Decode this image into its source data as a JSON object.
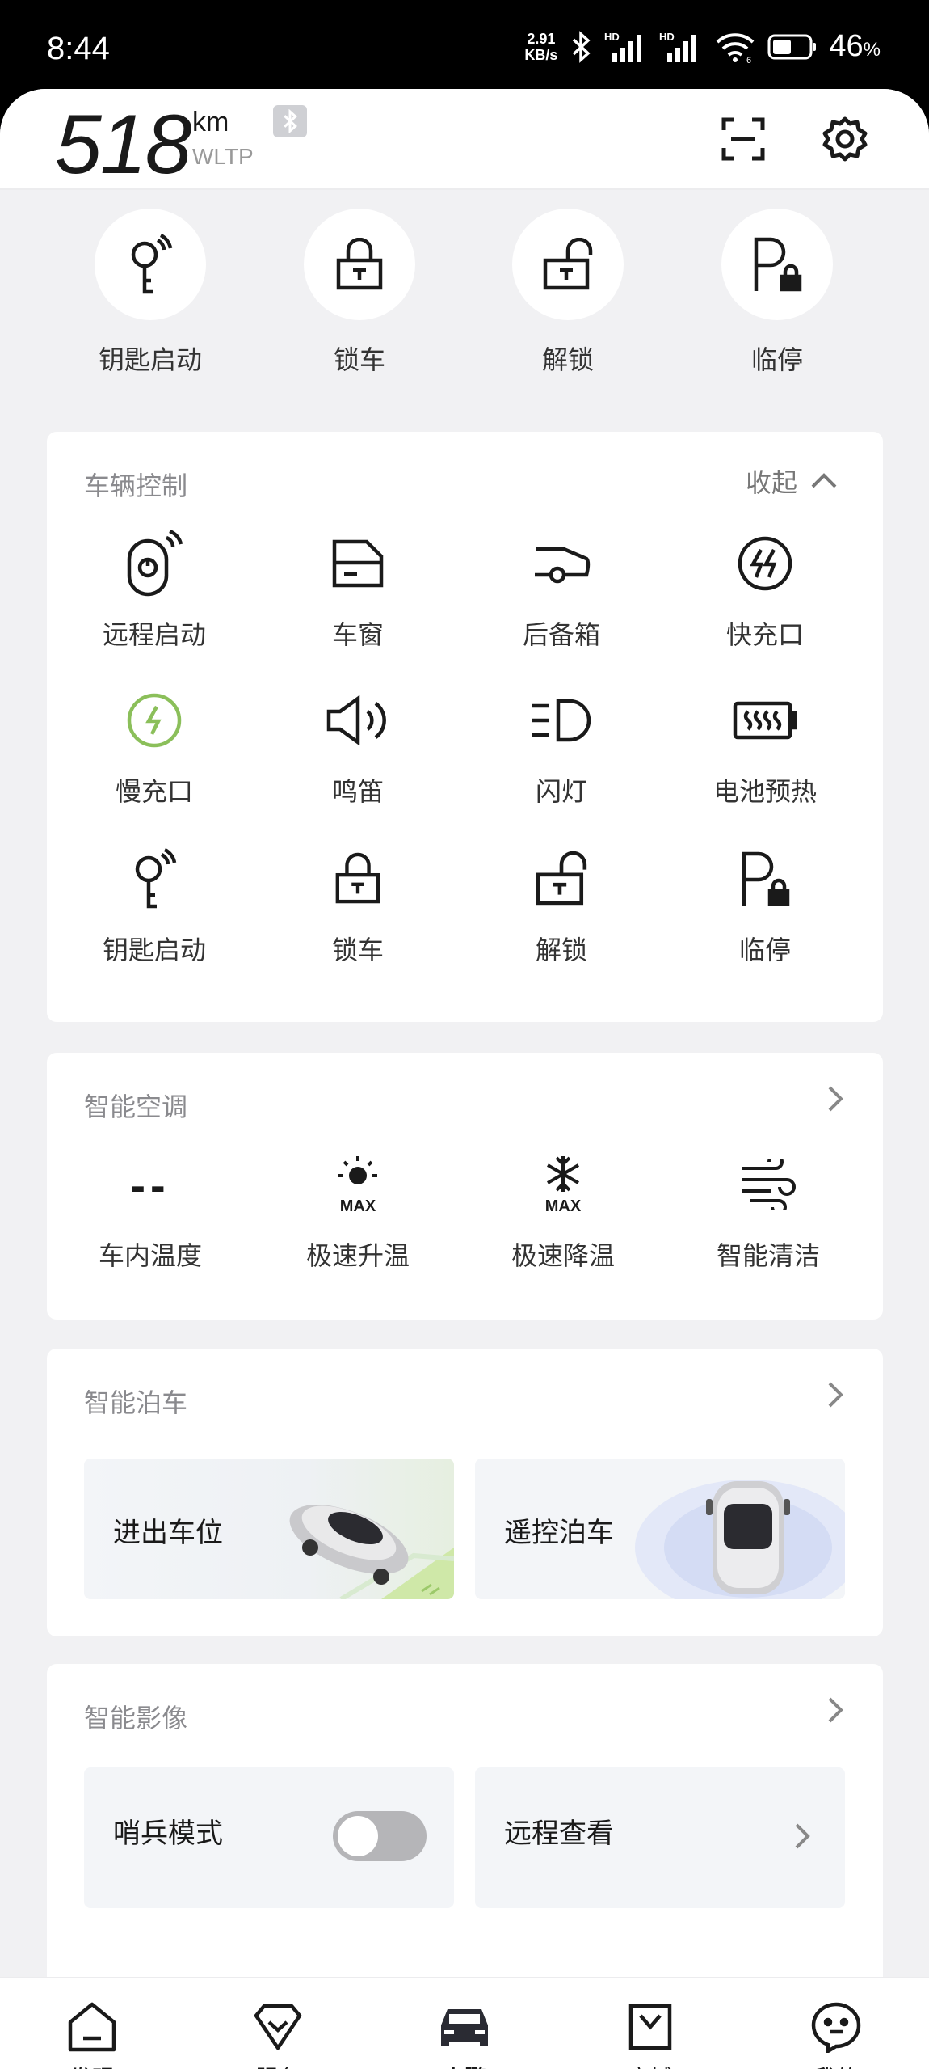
{
  "status_bar": {
    "time": "8:44",
    "net_speed_value": "2.91",
    "net_speed_unit": "KB/s",
    "battery_value": "46",
    "battery_unit": "%",
    "icons": [
      "bluetooth-icon",
      "signal-hd-1-icon",
      "signal-hd-2-icon",
      "wifi-icon",
      "battery-icon"
    ]
  },
  "header": {
    "range_value": "518",
    "range_unit": "km",
    "range_standard": "WLTP",
    "icons": [
      "bluetooth-badge-icon",
      "scan-icon",
      "settings-icon"
    ]
  },
  "quick_actions": [
    {
      "label": "钥匙启动",
      "icon": "key-start-icon"
    },
    {
      "label": "锁车",
      "icon": "lock-icon"
    },
    {
      "label": "解锁",
      "icon": "unlock-icon"
    },
    {
      "label": "临停",
      "icon": "temp-parking-icon"
    }
  ],
  "vehicle_control": {
    "title": "车辆控制",
    "collapse_label": "收起",
    "items": [
      {
        "label": "远程启动",
        "icon": "remote-start-icon"
      },
      {
        "label": "车窗",
        "icon": "window-icon"
      },
      {
        "label": "后备箱",
        "icon": "trunk-icon"
      },
      {
        "label": "快充口",
        "icon": "fast-charge-port-icon"
      },
      {
        "label": "慢充口",
        "icon": "slow-charge-port-icon"
      },
      {
        "label": "鸣笛",
        "icon": "horn-icon"
      },
      {
        "label": "闪灯",
        "icon": "flash-lights-icon"
      },
      {
        "label": "电池预热",
        "icon": "battery-preheat-icon"
      },
      {
        "label": "钥匙启动",
        "icon": "key-start-icon"
      },
      {
        "label": "锁车",
        "icon": "lock-icon"
      },
      {
        "label": "解锁",
        "icon": "unlock-icon"
      },
      {
        "label": "临停",
        "icon": "temp-parking-icon"
      }
    ]
  },
  "smart_ac": {
    "title": "智能空调",
    "temp_value": "--",
    "items": [
      {
        "label": "车内温度",
        "icon": "cabin-temp-icon"
      },
      {
        "label": "极速升温",
        "icon": "max-heat-icon"
      },
      {
        "label": "极速降温",
        "icon": "max-cool-icon"
      },
      {
        "label": "智能清洁",
        "icon": "smart-clean-icon"
      }
    ]
  },
  "smart_parking": {
    "title": "智能泊车",
    "tiles": [
      {
        "label": "进出车位"
      },
      {
        "label": "遥控泊车"
      }
    ]
  },
  "smart_imaging": {
    "title": "智能影像",
    "sentry_label": "哨兵模式",
    "sentry_on": false,
    "remote_view_label": "远程查看"
  },
  "tab_bar": {
    "active": "小鹏",
    "tabs": [
      {
        "label": "发现",
        "icon": "home-icon"
      },
      {
        "label": "服务",
        "icon": "service-icon"
      },
      {
        "label": "小鹏",
        "icon": "car-icon"
      },
      {
        "label": "商城",
        "icon": "shop-icon"
      },
      {
        "label": "我的",
        "icon": "profile-icon"
      }
    ]
  }
}
